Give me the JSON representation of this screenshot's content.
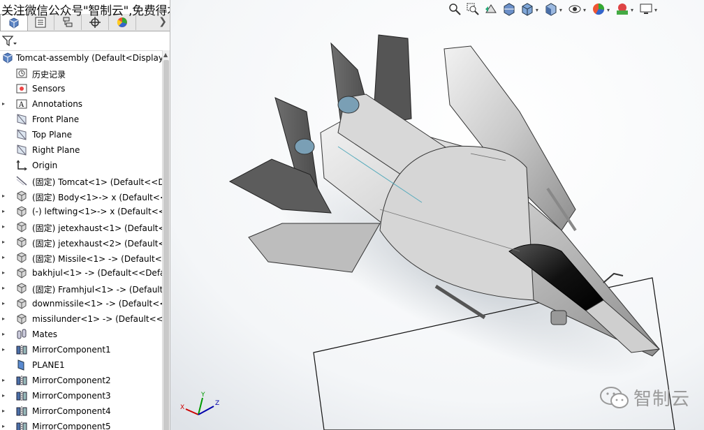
{
  "watermark_top": "关注微信公众号\"智制云\",免费得本图纸",
  "watermark_corner": "智制云",
  "tabs": [
    {
      "name": "feature-manager",
      "icon": "feature-manager-icon"
    },
    {
      "name": "property-manager",
      "icon": "property-manager-icon"
    },
    {
      "name": "configuration-manager",
      "icon": "configuration-manager-icon"
    },
    {
      "name": "dimxpert-manager",
      "icon": "dimxpert-icon"
    },
    {
      "name": "display-manager",
      "icon": "display-manager-icon"
    }
  ],
  "tree": {
    "root": "Tomcat-assembly  (Default<Display",
    "items": [
      {
        "label": "历史记录",
        "icon": "history-icon",
        "expander": ""
      },
      {
        "label": "Sensors",
        "icon": "sensors-icon",
        "expander": ""
      },
      {
        "label": "Annotations",
        "icon": "annotations-icon",
        "expander": "▸"
      },
      {
        "label": "Front Plane",
        "icon": "plane-icon",
        "expander": ""
      },
      {
        "label": "Top Plane",
        "icon": "plane-icon",
        "expander": ""
      },
      {
        "label": "Right Plane",
        "icon": "plane-icon",
        "expander": ""
      },
      {
        "label": "Origin",
        "icon": "origin-icon",
        "expander": ""
      },
      {
        "label": "(固定) Tomcat<1> (Default<<De",
        "icon": "sketch-icon",
        "expander": ""
      },
      {
        "label": "(固定) Body<1>-> x (Default<<",
        "icon": "part-icon",
        "expander": "▸"
      },
      {
        "label": "(-) leftwing<1>-> x (Default<<D",
        "icon": "part-icon",
        "expander": "▸"
      },
      {
        "label": "(固定) jetexhaust<1> (Default<<",
        "icon": "part-icon",
        "expander": "▸"
      },
      {
        "label": "(固定) jetexhaust<2> (Default<<",
        "icon": "part-icon",
        "expander": "▸"
      },
      {
        "label": "(固定) Missile<1> -> (Default<<",
        "icon": "part-icon",
        "expander": "▸"
      },
      {
        "label": "bakhjul<1> -> (Default<<Defau",
        "icon": "part-icon",
        "expander": "▸"
      },
      {
        "label": "(固定) Framhjul<1> -> (Default<",
        "icon": "part-icon",
        "expander": "▸"
      },
      {
        "label": "downmissile<1> -> (Default<<",
        "icon": "part-icon",
        "expander": "▸"
      },
      {
        "label": "missilunder<1> -> (Default<<D",
        "icon": "part-icon",
        "expander": "▸"
      },
      {
        "label": "Mates",
        "icon": "mates-icon",
        "expander": "▸"
      },
      {
        "label": "MirrorComponent1",
        "icon": "mirror-component-icon",
        "expander": "▸"
      },
      {
        "label": "PLANE1",
        "icon": "plane1-icon",
        "expander": ""
      },
      {
        "label": "MirrorComponent2",
        "icon": "mirror-component-icon",
        "expander": "▸"
      },
      {
        "label": "MirrorComponent3",
        "icon": "mirror-component-icon",
        "expander": "▸"
      },
      {
        "label": "MirrorComponent4",
        "icon": "mirror-component-icon",
        "expander": "▸"
      },
      {
        "label": "MirrorComponent5",
        "icon": "mirror-component-icon",
        "expander": "▸"
      }
    ]
  },
  "hud_buttons": [
    "zoom-to-fit-icon",
    "zoom-to-area-icon",
    "previous-view-icon",
    "section-view-icon",
    "view-orientation-icon",
    "display-style-icon",
    "hide-show-icon",
    "edit-appearance-icon",
    "apply-scene-icon",
    "view-settings-icon"
  ],
  "triad": {
    "x": "X",
    "y": "Y",
    "z": "Z"
  },
  "colors": {
    "accent": "#1f6fc5",
    "panel_bg": "#ffffff",
    "tab_bg": "#e8e8e8"
  }
}
